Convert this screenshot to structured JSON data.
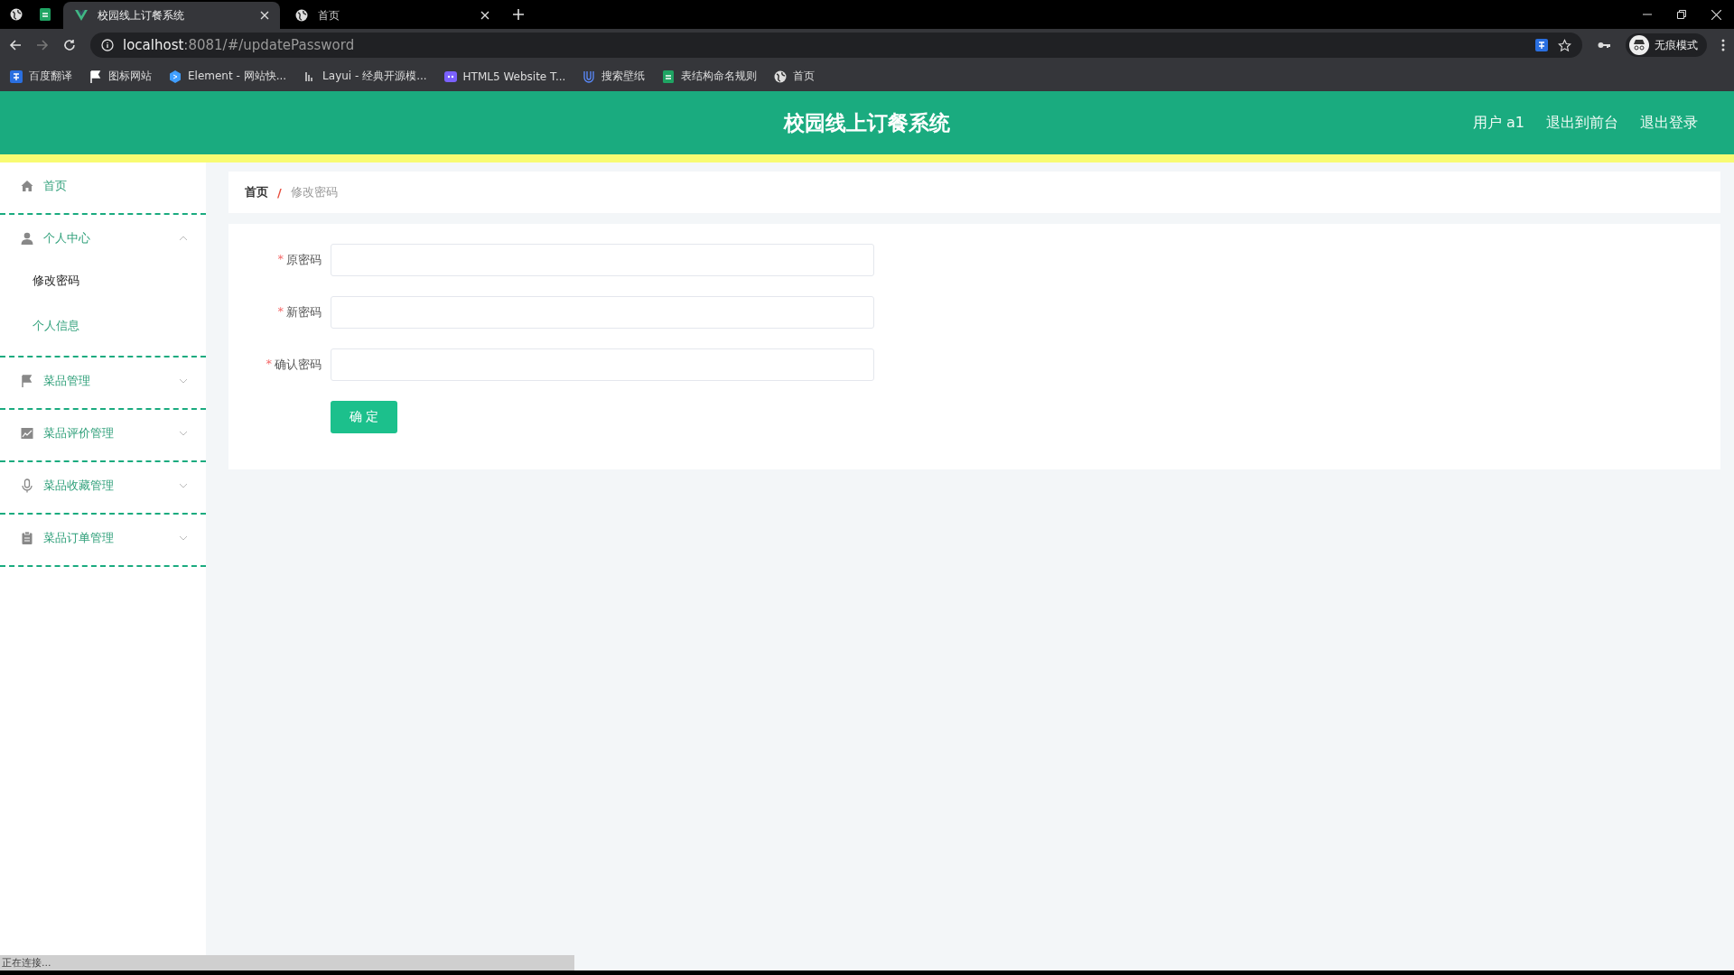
{
  "browser": {
    "tabs": [
      {
        "title": "校园线上订餐系统",
        "selected": true,
        "kind": "vue"
      },
      {
        "title": "首页",
        "selected": false,
        "kind": "globe"
      }
    ],
    "url_host": "localhost",
    "url_path": ":8081/#/updatePassword",
    "profile": "无痕模式",
    "bookmarks": [
      {
        "title": "百度翻译",
        "kind": "translate"
      },
      {
        "title": "图标网站",
        "kind": "flag"
      },
      {
        "title": "Element - 网站快...",
        "kind": "hexagon"
      },
      {
        "title": "Layui - 经典开源模...",
        "kind": "layui"
      },
      {
        "title": "HTML5 Website T...",
        "kind": "cat"
      },
      {
        "title": "搜索壁纸",
        "kind": "u"
      },
      {
        "title": "表结构命名规则",
        "kind": "sheet"
      },
      {
        "title": "首页",
        "kind": "globe"
      }
    ]
  },
  "header": {
    "title": "校园线上订餐系统",
    "links": [
      "用户 a1",
      "退出到前台",
      "退出登录"
    ]
  },
  "sidebar": {
    "items": [
      {
        "label": "首页",
        "kind": "home"
      },
      {
        "label": "个人中心",
        "kind": "user",
        "expanded": true,
        "children": [
          {
            "label": "修改密码",
            "selected": true
          },
          {
            "label": "个人信息",
            "selected": false
          }
        ]
      },
      {
        "label": "菜品管理",
        "kind": "flag",
        "expanded": false
      },
      {
        "label": "菜品评价管理",
        "kind": "chart",
        "expanded": false
      },
      {
        "label": "菜品收藏管理",
        "kind": "mic",
        "expanded": false
      },
      {
        "label": "菜品订单管理",
        "kind": "clipboard",
        "expanded": false
      }
    ]
  },
  "breadcrumb": {
    "home": "首页",
    "separator": "/",
    "current": "修改密码"
  },
  "form": {
    "fields": [
      {
        "required_mark": "*",
        "label": "原密码"
      },
      {
        "required_mark": "*",
        "label": "新密码"
      },
      {
        "required_mark": "*",
        "label": "确认密码"
      }
    ],
    "submit": "确 定"
  },
  "status_bar": "正在连接..."
}
